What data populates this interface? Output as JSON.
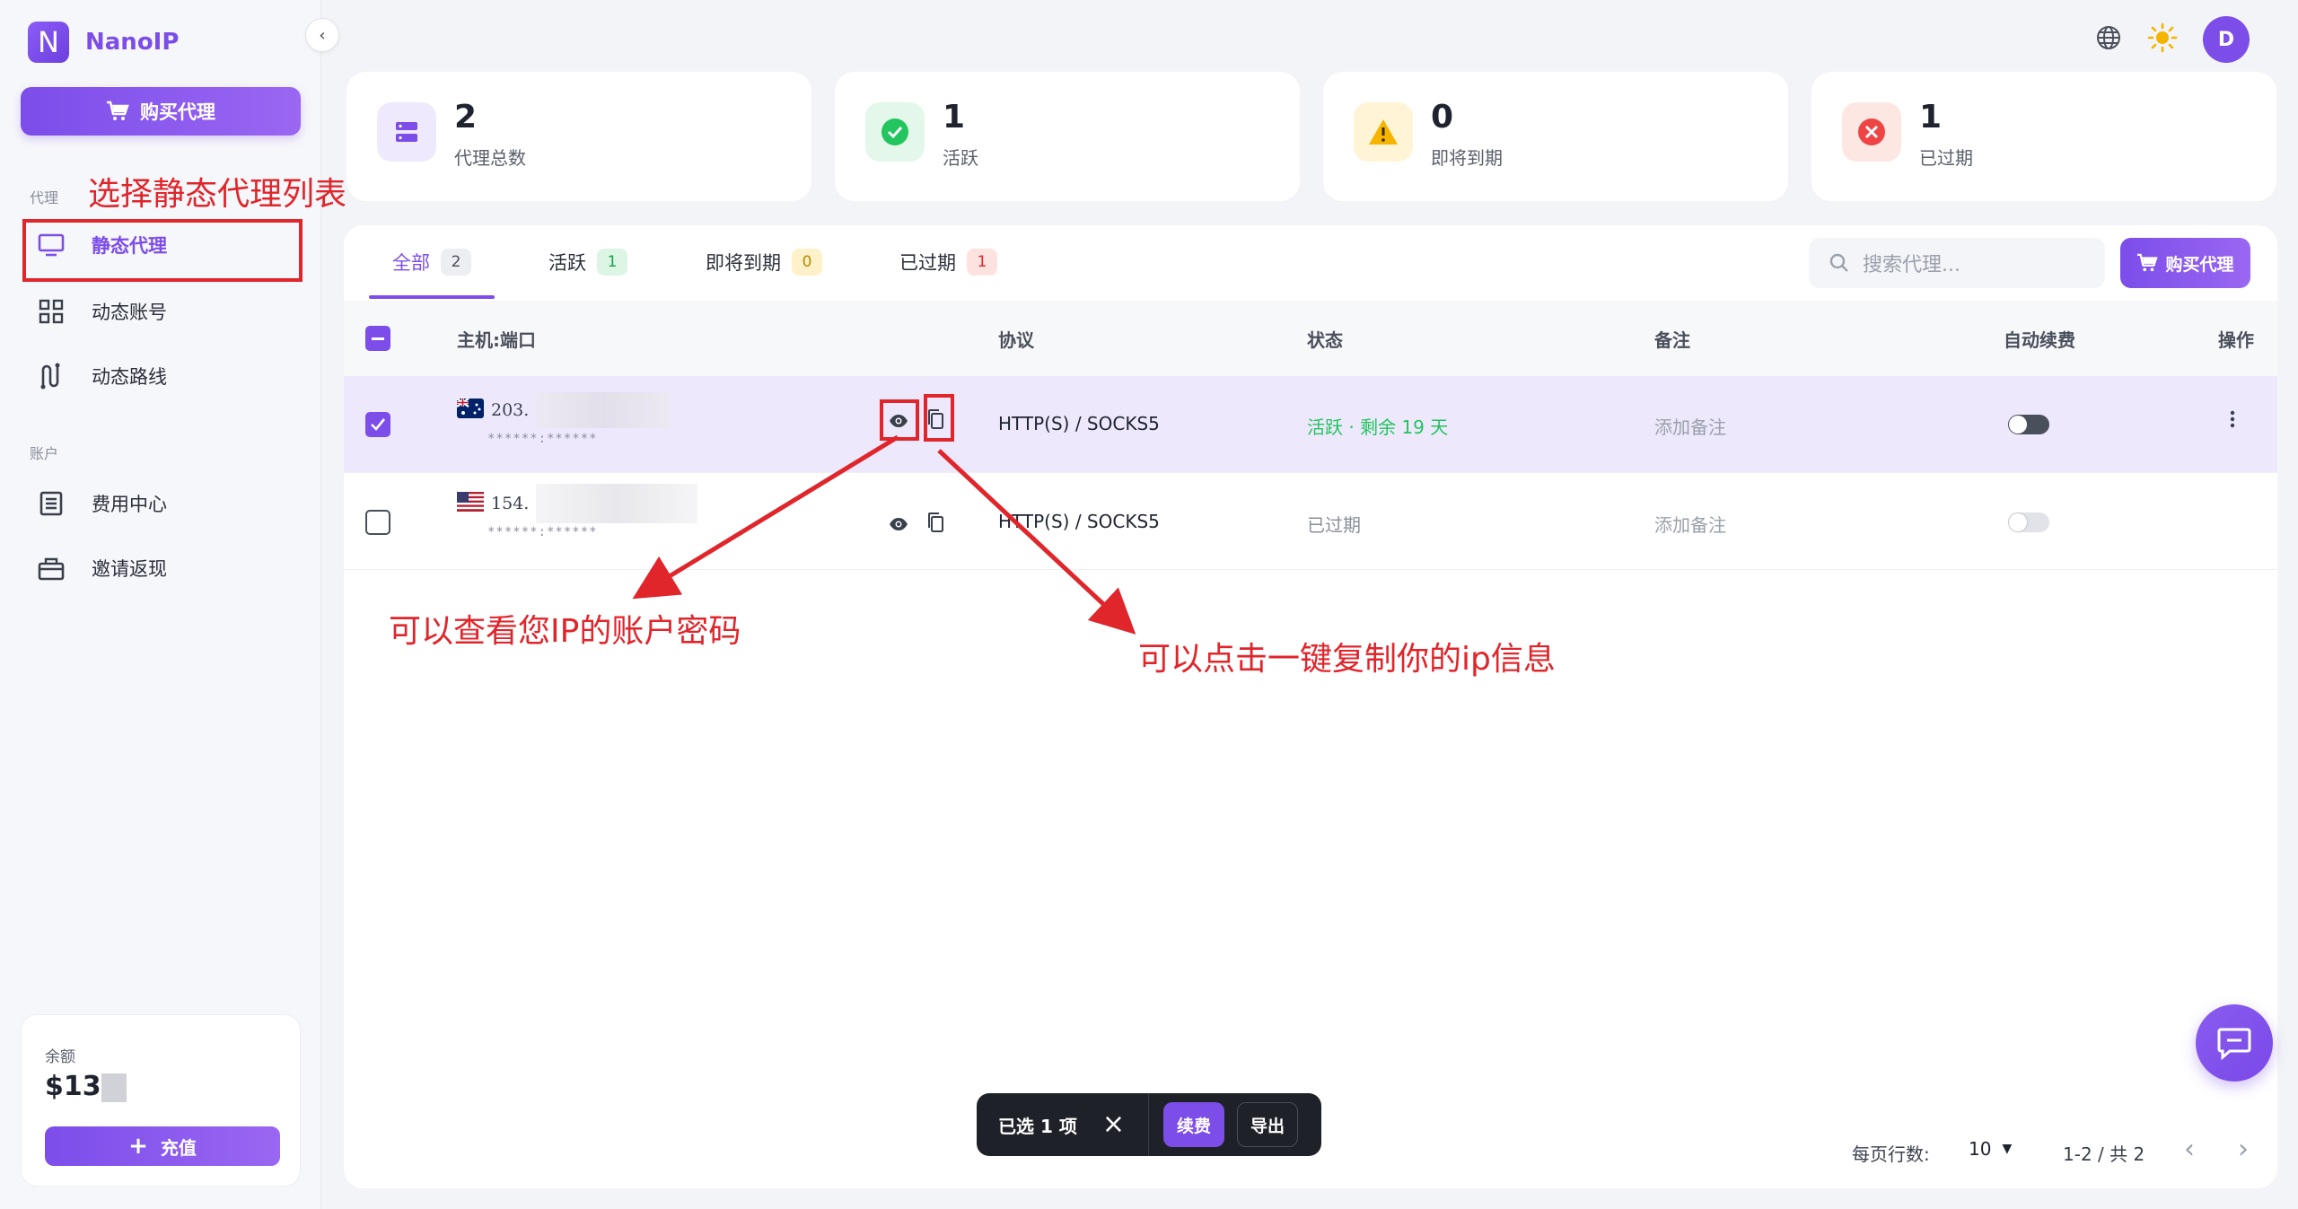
{
  "app": {
    "name": "NanoIP",
    "logo_letter": "N"
  },
  "sidebar": {
    "buy_button": "购买代理",
    "section_proxy": "代理",
    "section_account": "账户",
    "items": [
      {
        "label": "静态代理",
        "icon": "monitor-icon",
        "active": true
      },
      {
        "label": "动态账号",
        "icon": "grid-icon",
        "active": false
      },
      {
        "label": "动态路线",
        "icon": "route-icon",
        "active": false
      },
      {
        "label": "费用中心",
        "icon": "receipt-icon",
        "active": false
      },
      {
        "label": "邀请返现",
        "icon": "gift-icon",
        "active": false
      }
    ],
    "balance": {
      "label": "余额",
      "value": "$13",
      "recharge": "充值"
    }
  },
  "topbar": {
    "avatar": "D",
    "language_icon": "globe-icon",
    "theme_icon": "sun-icon"
  },
  "stats": [
    {
      "value": "2",
      "label": "代理总数",
      "icon": "server-icon",
      "color": "#7c4de9",
      "bg": "#efe9fd"
    },
    {
      "value": "1",
      "label": "活跃",
      "icon": "check-circle-icon",
      "color": "#22c55e",
      "bg": "#e3f8ea"
    },
    {
      "value": "0",
      "label": "即将到期",
      "icon": "warning-icon",
      "color": "#f5b400",
      "bg": "#fff4d6"
    },
    {
      "value": "1",
      "label": "已过期",
      "icon": "x-circle-icon",
      "color": "#ef4444",
      "bg": "#fde7e3"
    }
  ],
  "tabs": [
    {
      "label": "全部",
      "count": "2"
    },
    {
      "label": "活跃",
      "count": "1"
    },
    {
      "label": "即将到期",
      "count": "0"
    },
    {
      "label": "已过期",
      "count": "1"
    }
  ],
  "search": {
    "placeholder": "搜索代理..."
  },
  "buy_small": "购买代理",
  "table": {
    "columns": [
      "主机:端口",
      "协议",
      "状态",
      "备注",
      "自动续费",
      "操作"
    ],
    "rows": [
      {
        "ip": "203.",
        "cred": "******:******",
        "protocol": "HTTP(S) / SOCKS5",
        "status": "活跃 · 剩余 19 天",
        "status_color": "#22c55e",
        "note": "添加备注",
        "selected": true
      },
      {
        "ip": "154.",
        "cred": "******:******",
        "protocol": "HTTP(S) / SOCKS5",
        "status": "已过期",
        "status_color": "#8a8f9c",
        "note": "添加备注",
        "selected": false
      }
    ]
  },
  "bulk_bar": {
    "selected": "已选 1 项",
    "renew": "续费",
    "export": "导出"
  },
  "pagination": {
    "rows_label": "每页行数:",
    "rows_value": "10",
    "range": "1-2 / 共 2"
  },
  "annotations": {
    "select_static": "选择静态代理列表",
    "view_password": "可以查看您IP的账户密码",
    "copy_info": "可以点击一键复制你的ip信息"
  }
}
